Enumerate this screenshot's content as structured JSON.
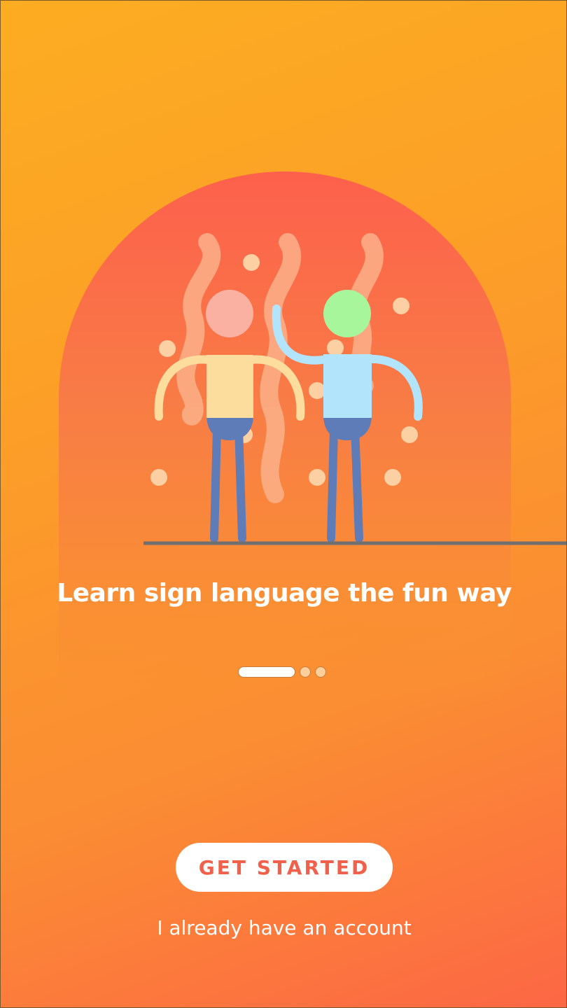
{
  "onboarding": {
    "headline": "Learn sign language the fun way",
    "pager": {
      "total_pages": 3,
      "current_page": 1
    },
    "cta_label": "GET STARTED",
    "secondary_link": "I already have an account"
  },
  "illustration": {
    "figures": [
      "person-left",
      "person-right"
    ]
  },
  "colors": {
    "background_top": "#fdad22",
    "background_bottom": "#fc6745",
    "arch": "#fd604c",
    "cta_text": "#f0604a",
    "cta_bg": "#ffffff",
    "figure_left_head": "#fbb1a1",
    "figure_left_body": "#fddd9e",
    "figure_right_head": "#a8f69c",
    "figure_right_body": "#b2e4fb",
    "legs": "#5e7db8"
  }
}
